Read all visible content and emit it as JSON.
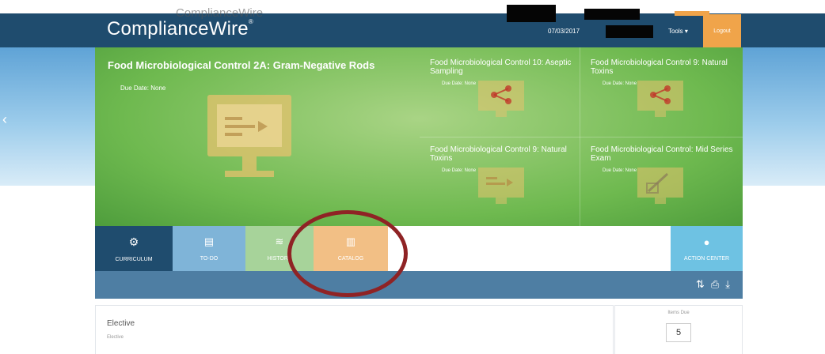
{
  "header": {
    "brand": "ComplianceWire",
    "brand_mark": "®",
    "brand_ghost": "ComplianceWire",
    "date": "07/03/2017",
    "tools_label": "Tools ▾",
    "logout_label": "Logout"
  },
  "tiles": {
    "main": {
      "title": "Food Microbiological Control 2A: Gram-Negative Rods",
      "due": "Due Date: None"
    },
    "small": [
      {
        "title": "Food Microbiological Control 10: Aseptic Sampling",
        "due": "Due Date: None"
      },
      {
        "title": "Food Microbiological Control 9: Natural Toxins",
        "due": "Due Date: None"
      },
      {
        "title": "Food Microbiological Control 9: Natural Toxins",
        "due": "Due Date: None"
      },
      {
        "title": "Food Microbiological Control: Mid Series Exam",
        "due": "Due Date: None"
      }
    ]
  },
  "nav": {
    "tabs": [
      {
        "label": "CURRICULUM",
        "color": "#1f4c6e"
      },
      {
        "label": "TO-DO",
        "color": "#7fb4d8"
      },
      {
        "label": "HISTORY",
        "color": "#a7d39a"
      },
      {
        "label": "CATALOG",
        "color": "#f2bf85"
      }
    ],
    "action_center": {
      "label": "ACTION CENTER",
      "color": "#6ec2e3"
    }
  },
  "card": {
    "title": "Elective",
    "subtitle": "Elective",
    "items_due_label": "Items Due",
    "items_due_count": "5"
  }
}
